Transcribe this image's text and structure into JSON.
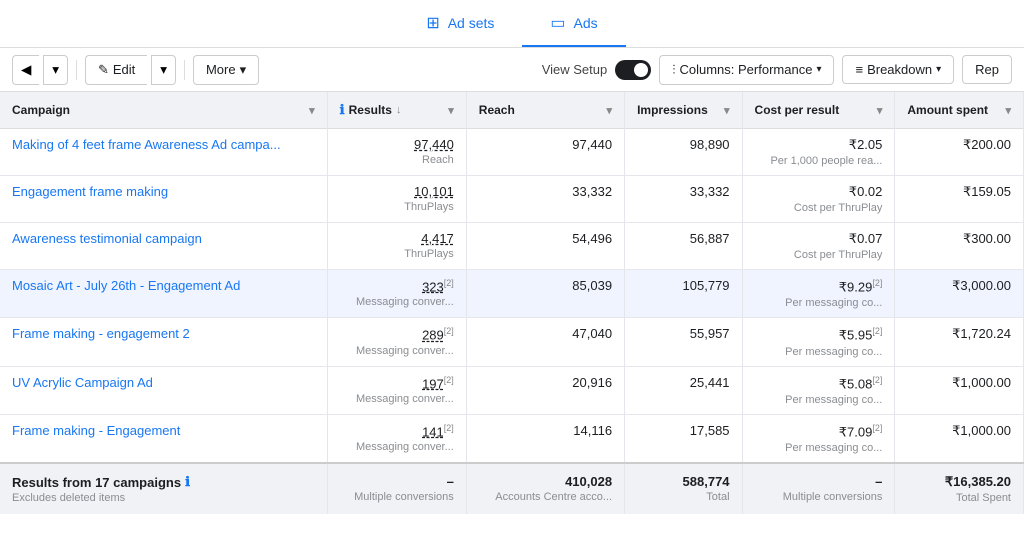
{
  "nav": {
    "tabs": [
      {
        "id": "adsets",
        "label": "Ad sets",
        "icon": "⊞",
        "active": false
      },
      {
        "id": "ads",
        "label": "Ads",
        "icon": "▭",
        "active": false
      }
    ]
  },
  "toolbar": {
    "edit_label": "Edit",
    "more_label": "More",
    "view_setup_label": "View Setup",
    "columns_label": "Columns: Performance",
    "breakdown_label": "Breakdown",
    "report_label": "Rep"
  },
  "table": {
    "columns": [
      {
        "id": "campaign",
        "label": "Campaign",
        "sortable": true
      },
      {
        "id": "results",
        "label": "Results",
        "sortable": true,
        "info": true,
        "sort_dir": "desc"
      },
      {
        "id": "reach",
        "label": "Reach",
        "sortable": true
      },
      {
        "id": "impressions",
        "label": "Impressions",
        "sortable": true
      },
      {
        "id": "cost_per_result",
        "label": "Cost per result",
        "sortable": true
      },
      {
        "id": "amount_spent",
        "label": "Amount spent",
        "sortable": true
      }
    ],
    "rows": [
      {
        "id": 1,
        "campaign": "Making of 4 feet frame Awareness Ad campa...",
        "results": "97,440",
        "results_sub": "Reach",
        "reach": "97,440",
        "reach_sub": "",
        "impressions": "98,890",
        "impressions_sub": "",
        "cost_per_result": "₹2.05",
        "cost_per_result_sub": "Per 1,000 people rea...",
        "amount_spent": "₹200.00",
        "amount_spent_sub": "",
        "highlighted": false,
        "result_superscript": ""
      },
      {
        "id": 2,
        "campaign": "Engagement frame making",
        "results": "10,101",
        "results_sub": "ThruPlays",
        "reach": "33,332",
        "reach_sub": "",
        "impressions": "33,332",
        "impressions_sub": "",
        "cost_per_result": "₹0.02",
        "cost_per_result_sub": "Cost per ThruPlay",
        "amount_spent": "₹159.05",
        "amount_spent_sub": "",
        "highlighted": false,
        "result_superscript": ""
      },
      {
        "id": 3,
        "campaign": "Awareness testimonial campaign",
        "results": "4,417",
        "results_sub": "ThruPlays",
        "reach": "54,496",
        "reach_sub": "",
        "impressions": "56,887",
        "impressions_sub": "",
        "cost_per_result": "₹0.07",
        "cost_per_result_sub": "Cost per ThruPlay",
        "amount_spent": "₹300.00",
        "amount_spent_sub": "",
        "highlighted": false,
        "result_superscript": ""
      },
      {
        "id": 4,
        "campaign": "Mosaic Art - July 26th - Engagement Ad",
        "results": "323",
        "results_sub": "Messaging conver...",
        "reach": "85,039",
        "reach_sub": "",
        "impressions": "105,779",
        "impressions_sub": "",
        "cost_per_result": "₹9.29",
        "cost_per_result_sub": "Per messaging co...",
        "amount_spent": "₹3,000.00",
        "amount_spent_sub": "",
        "highlighted": true,
        "result_superscript": "[2]"
      },
      {
        "id": 5,
        "campaign": "Frame making - engagement 2",
        "results": "289",
        "results_sub": "Messaging conver...",
        "reach": "47,040",
        "reach_sub": "",
        "impressions": "55,957",
        "impressions_sub": "",
        "cost_per_result": "₹5.95",
        "cost_per_result_sub": "Per messaging co...",
        "amount_spent": "₹1,720.24",
        "amount_spent_sub": "",
        "highlighted": false,
        "result_superscript": "[2]"
      },
      {
        "id": 6,
        "campaign": "UV Acrylic Campaign Ad",
        "results": "197",
        "results_sub": "Messaging conver...",
        "reach": "20,916",
        "reach_sub": "",
        "impressions": "25,441",
        "impressions_sub": "",
        "cost_per_result": "₹5.08",
        "cost_per_result_sub": "Per messaging co...",
        "amount_spent": "₹1,000.00",
        "amount_spent_sub": "",
        "highlighted": false,
        "result_superscript": "[2]"
      },
      {
        "id": 7,
        "campaign": "Frame making - Engagement",
        "results": "141",
        "results_sub": "Messaging conver...",
        "reach": "14,116",
        "reach_sub": "",
        "impressions": "17,585",
        "impressions_sub": "",
        "cost_per_result": "₹7.09",
        "cost_per_result_sub": "Per messaging co...",
        "amount_spent": "₹1,000.00",
        "amount_spent_sub": "",
        "highlighted": false,
        "result_superscript": "[2]"
      }
    ],
    "footer": {
      "label": "Results from 17 campaigns",
      "sub_label": "Excludes deleted items",
      "results": "–",
      "results_sub": "Multiple conversions",
      "reach": "410,028",
      "reach_sub": "Accounts Centre acco...",
      "impressions": "588,774",
      "impressions_sub": "Total",
      "cost_per_result": "–",
      "cost_per_result_sub": "Multiple conversions",
      "amount_spent": "₹16,385.20",
      "amount_spent_sub": "Total Spent"
    }
  },
  "colors": {
    "accent": "#1877f2",
    "highlight_row": "#f0f4ff",
    "header_bg": "#f0f2f5"
  }
}
